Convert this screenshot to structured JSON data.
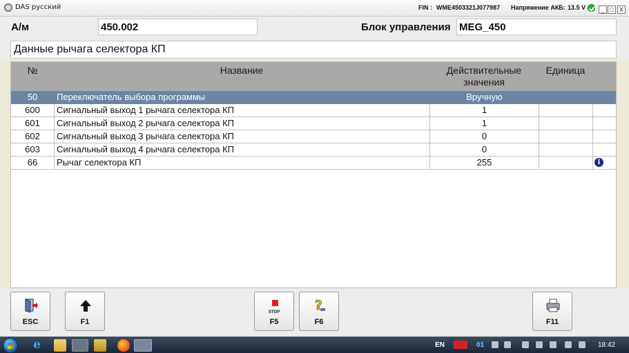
{
  "window": {
    "title": "DAS русский",
    "fin_label": "FIN :",
    "fin_value": "WME4503321J077987",
    "akb_label": "Напряжение АКБ:",
    "akb_value": "13.5 V",
    "min_glyph": "_",
    "max_glyph": "□",
    "close_glyph": "X"
  },
  "header": {
    "am_label": "А/м",
    "am_value": "450.002",
    "ecu_label": "Блок управления",
    "ecu_value": "MEG_450",
    "section_title": "Данные рычага селектора КП"
  },
  "table": {
    "columns": {
      "num": "№",
      "name": "Название",
      "value": "Действительные значения",
      "unit": "Единица"
    },
    "rows": [
      {
        "num": "50",
        "name": "Переключатель выбора программы",
        "value": "Вручную",
        "unit": "",
        "selected": true,
        "info": false
      },
      {
        "num": "600",
        "name": "Сигнальный выход 1 рычага селектора КП",
        "value": "1",
        "unit": "",
        "selected": false,
        "info": false
      },
      {
        "num": "601",
        "name": "Сигнальный выход 2 рычага селектора КП",
        "value": "1",
        "unit": "",
        "selected": false,
        "info": false
      },
      {
        "num": "602",
        "name": "Сигнальный выход 3 рычага селектора КП",
        "value": "0",
        "unit": "",
        "selected": false,
        "info": false
      },
      {
        "num": "603",
        "name": "Сигнальный выход 4 рычага селектора КП",
        "value": "0",
        "unit": "",
        "selected": false,
        "info": false
      },
      {
        "num": "66",
        "name": "Рычаг селектора КП",
        "value": "255",
        "unit": "",
        "selected": false,
        "info": true
      }
    ],
    "info_glyph": "i",
    "selected_color": "#6d85a5"
  },
  "buttons": {
    "esc": {
      "label": "ESC",
      "icon": "exit-door-icon"
    },
    "f1": {
      "label": "F1",
      "icon": "arrow-up-icon"
    },
    "f5": {
      "label": "F5",
      "icon": "stop-icon",
      "stop_text": "STOP"
    },
    "f6": {
      "label": "F6",
      "icon": "help-question-icon"
    },
    "f11": {
      "label": "F11",
      "icon": "printer-icon"
    }
  },
  "taskbar": {
    "lang": "EN",
    "tray_num": "01",
    "clock": "18:42"
  }
}
